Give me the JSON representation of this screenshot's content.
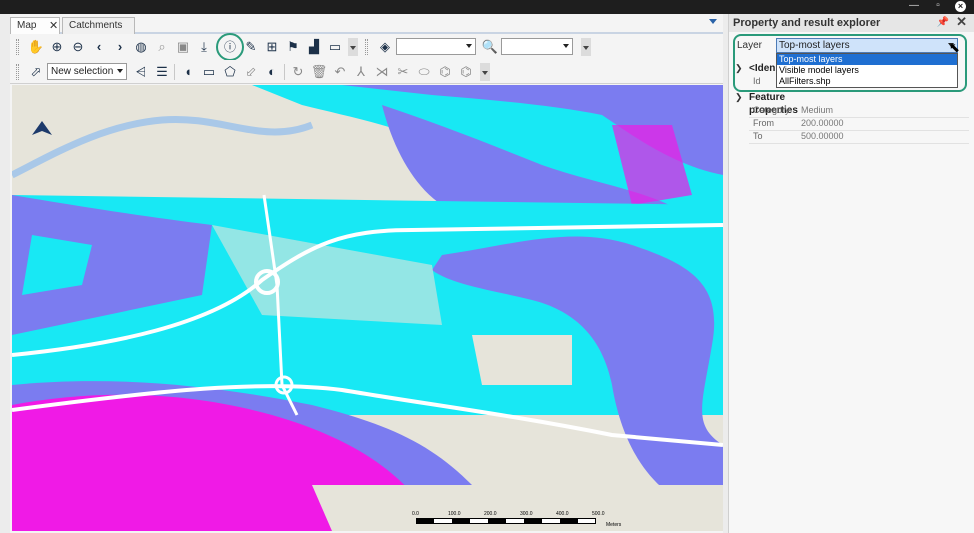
{
  "tabs": [
    {
      "label": "Map",
      "active": true
    },
    {
      "label": "Catchments",
      "active": false
    }
  ],
  "toolbar1": {
    "layer_combo_value": "",
    "search_combo_value": ""
  },
  "toolbar2": {
    "selection_mode": "New selection"
  },
  "map": {
    "scale_labels": [
      "0.0",
      "100.0",
      "200.0",
      "300.0",
      "400.0",
      "500.0"
    ],
    "scale_unit": "Meters",
    "colors": {
      "background": "#e6e4da",
      "river": "#a9c8e8",
      "flood_high": "#7b7cf0",
      "flood_medium": "#18e8f4",
      "flood_extreme": "#f01ae6",
      "road": "#ffffff"
    }
  },
  "panel": {
    "title": "Property and result explorer",
    "layer_label": "Layer",
    "layer_value": "Top-most layers",
    "dropdown_options": [
      "Top-most layers",
      "Visible model layers",
      "AllFilters.shp"
    ],
    "identity_group": "<Iden",
    "id_key": "Id",
    "feature_group": "Feature properties",
    "properties": [
      {
        "key": "Category",
        "value": "Medium"
      },
      {
        "key": "From",
        "value": "200.00000"
      },
      {
        "key": "To",
        "value": "500.00000"
      }
    ]
  }
}
